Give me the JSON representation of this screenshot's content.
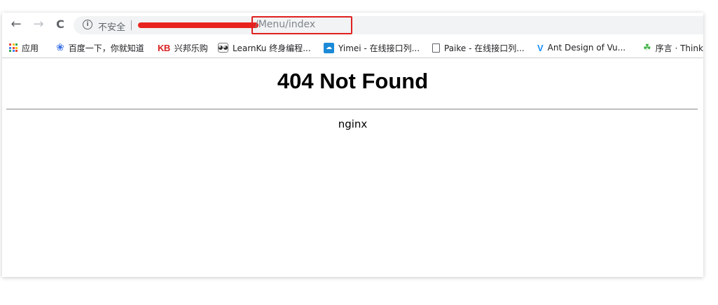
{
  "browser": {
    "nav": {
      "back_icon": "←",
      "forward_icon": "→",
      "reload_icon": "C"
    },
    "address_bar": {
      "security_icon": "i",
      "security_label": "不安全",
      "url_redacted": true,
      "url_visible_path": "/Menu/index",
      "highlight_color": "#e02020"
    },
    "bookmarks": [
      {
        "icon": "apps-grid-icon",
        "label": "应用"
      },
      {
        "icon": "baidu-paw-icon",
        "label": "百度一下，你就知道"
      },
      {
        "icon": "kb-icon",
        "icon_text": "KB",
        "label": "兴邦乐购"
      },
      {
        "icon": "learnku-panda-icon",
        "label": "LearnKu 终身编程..."
      },
      {
        "icon": "cloud-icon",
        "label": "Yimei - 在线接口列..."
      },
      {
        "icon": "page-icon",
        "label": "Paike - 在线接口列..."
      },
      {
        "icon": "vue-ant-icon",
        "icon_text": "V",
        "label": "Ant Design of Vu..."
      },
      {
        "icon": "thinkphp-leaf-icon",
        "label": "序言 · Think"
      }
    ]
  },
  "page": {
    "heading": "404 Not Found",
    "server": "nginx"
  }
}
